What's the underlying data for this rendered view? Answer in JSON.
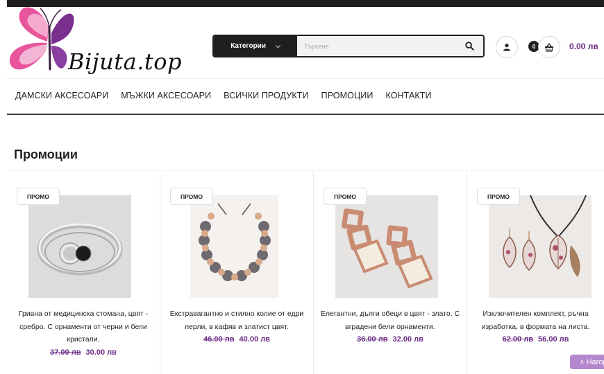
{
  "logo": {
    "text": "Bijuta.top"
  },
  "search": {
    "category_label": "Категории",
    "placeholder": "Търсене"
  },
  "cart": {
    "count": "0",
    "total": "0.00 лв"
  },
  "nav": {
    "items": [
      "ДАМСКИ АКСЕСОАРИ",
      "МЪЖКИ АКСЕСОАРИ",
      "ВСИЧКИ ПРОДУКТИ",
      "ПРОМОЦИИ",
      "КОНТАКТИ"
    ]
  },
  "section": {
    "title": "Промоции"
  },
  "products": [
    {
      "badge": "ПРОМО",
      "title": "Гривна от медицинска стомана, цвят - сребро. С орнаменти от черни и бели кристали.",
      "old_price": "37.00 лв",
      "new_price": "30.00 лв"
    },
    {
      "badge": "ПРОМО",
      "title": "Екстравагантно и стилно колие от едри перли, в кафяв и златист цвят.",
      "old_price": "46.00 лв",
      "new_price": "40.00 лв"
    },
    {
      "badge": "ПРОМО",
      "title": "Елегантни, дълги обеци в цвят - злато. С вградени бели орнаменти.",
      "old_price": "36.00 лв",
      "new_price": "32.00 лв"
    },
    {
      "badge": "ПРОМО",
      "title": "Изключителен комплект, ръчна изработка, в формата на листа.",
      "old_price": "62.00 лв",
      "new_price": "56.00 лв"
    }
  ],
  "to_top": {
    "label": "Нагоре"
  },
  "colors": {
    "accent": "#6b2c86",
    "dark": "#1f1f1f",
    "logo_pink": "#e8559c",
    "logo_purple": "#7a2f8f"
  }
}
